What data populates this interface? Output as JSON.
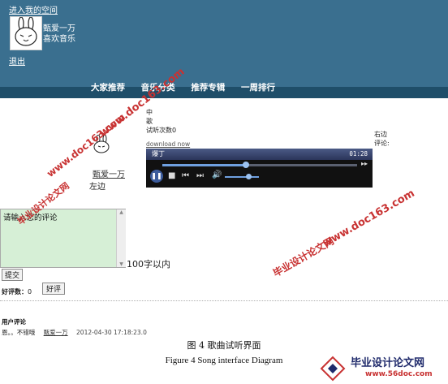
{
  "header": {
    "enter_space": "进入我的空间",
    "username": "甄爱一万",
    "subtitle": "喜欢音乐",
    "logout": "退出",
    "nav": [
      "大家推荐",
      "音乐分类",
      "推荐专辑",
      "一周排行"
    ]
  },
  "song": {
    "line1": "中",
    "line2": "歌",
    "plays": "试听次数0",
    "download": "download now",
    "right_label": "右边",
    "comments_label": "评论:"
  },
  "player": {
    "title": "爆丁",
    "time": "01:28",
    "progress": 0.43,
    "volume": 0.7
  },
  "left": {
    "name": "甄爱一万",
    "label": "左边"
  },
  "comment_box": {
    "value": "请输入您的评论",
    "limit": "100字以内",
    "submit": "提交"
  },
  "rating": {
    "label": "好评数：",
    "count": "0",
    "button": "好评"
  },
  "user_comments": {
    "title": "用户评论",
    "items": [
      {
        "text": "恩。。不错哦",
        "user": "甄爱一万",
        "date": "2012-04-30 17:18:23.0"
      }
    ]
  },
  "caption": {
    "cn": "图 4  歌曲试听界面",
    "en": "Figure 4 Song interface Diagram"
  },
  "watermark": {
    "url": "www.doc163.com",
    "site": "毕业设计论文网",
    "corner_site": "毕业设计论文网",
    "corner_url": "www.56doc.com"
  },
  "colors": {
    "header_bg": "#3a6f8f",
    "header_strip": "#1f4e69",
    "comment_bg": "#d6efd6",
    "watermark": "#c83232"
  }
}
